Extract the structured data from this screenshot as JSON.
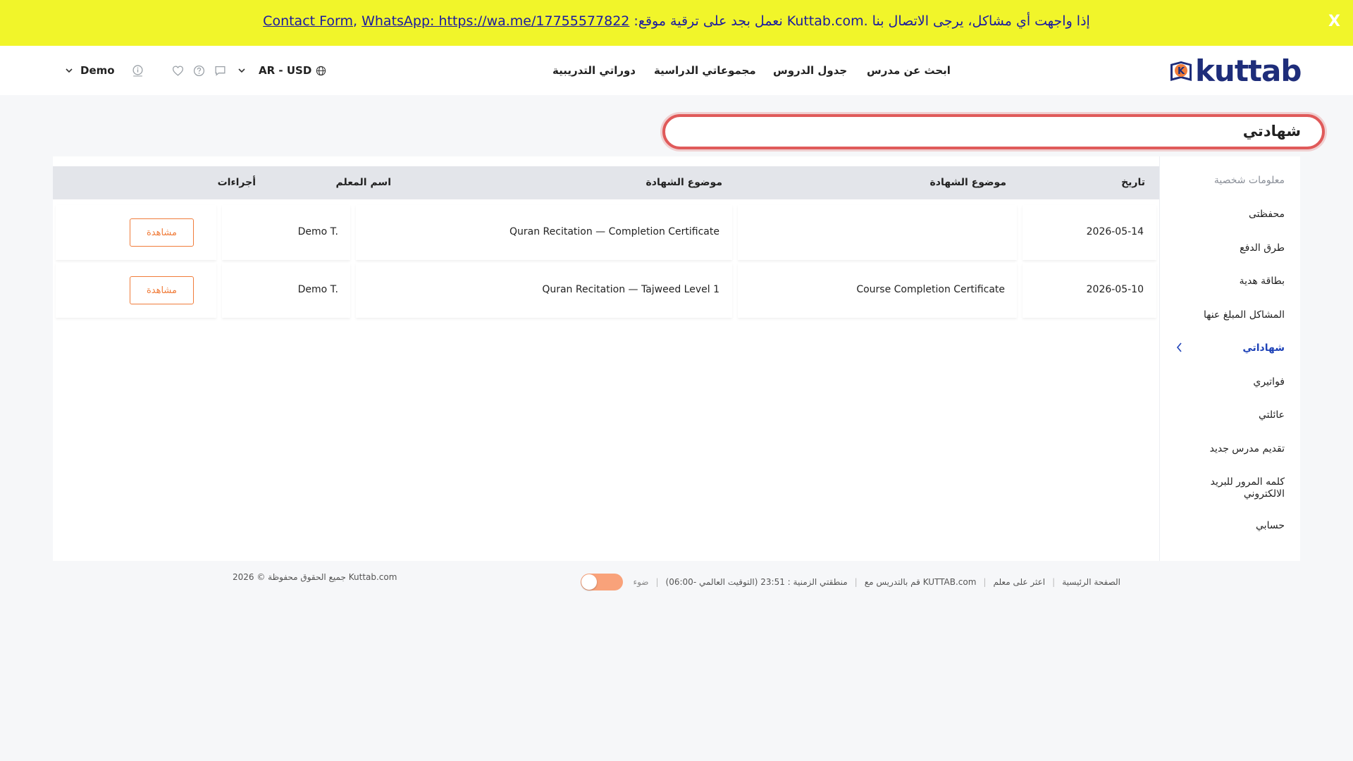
{
  "banner": {
    "link_contact": "Contact Form",
    "comma": ", ",
    "link_whatsapp": "WhatsApp: https://wa.me/17755577822",
    "message": " :نعمل بجد على ترقية موقع Kuttab.com. إذا واجهت أي مشاكل، يرجى الاتصال بنا",
    "close": "X"
  },
  "header": {
    "logo_text": "kuttab",
    "logo_letter": "K",
    "nav": {
      "find_teacher": "ابحث عن مدرس",
      "schedule": "جدول الدروس",
      "groups": "مجموعاتي الدراسية",
      "courses": "دوراتي التدريبية"
    },
    "locale": "AR - USD",
    "user": "Demo"
  },
  "page": {
    "title": "شهادتي"
  },
  "sidebar": {
    "items": [
      {
        "label": "معلومات شخصية"
      },
      {
        "label": "محفظتى"
      },
      {
        "label": "طرق الدفع"
      },
      {
        "label": "بطاقة هدية"
      },
      {
        "label": "المشاكل المبلغ عنها"
      },
      {
        "label": "شهاداتي"
      },
      {
        "label": "فواتيري"
      },
      {
        "label": "عائلتي"
      },
      {
        "label": "تقديم مدرس جديد"
      },
      {
        "label": "كلمه المرور للبريد الالكتروني"
      },
      {
        "label": "حسابي"
      }
    ]
  },
  "table": {
    "headers": {
      "date": "تاريخ",
      "type": "موضوع الشهادة",
      "subject": "موضوع الشهادة",
      "teacher": "اسم المعلم",
      "actions": "أجراءات"
    },
    "rows": [
      {
        "date": "2026-05-14",
        "type": "",
        "subject": "Quran Recitation — Completion Certificate",
        "teacher": "Demo T.",
        "action": "مشاهدة"
      },
      {
        "date": "2026-05-10",
        "type": "Course Completion Certificate",
        "subject": "Quran Recitation — Tajweed Level 1",
        "teacher": "Demo T.",
        "action": "مشاهدة"
      }
    ]
  },
  "footer": {
    "copyright": "جميع الحقوق محفوظة © 2026 Kuttab.com",
    "links": {
      "home": "الصفحة الرئيسية",
      "find_teacher": "اعثر على معلم",
      "teach": "قم بالتدريس مع KUTTAB.com",
      "timezone": "منطقتي الزمنية : 23:51 (التوقيت العالمي -06:00)",
      "light": "ضوء"
    }
  },
  "colors": {
    "banner_bg": "#f1f52a",
    "brand_navy": "#1e2d7a",
    "brand_orange": "#f07c3a",
    "active_blue": "#1f43b8",
    "title_border": "#e05a5a"
  }
}
